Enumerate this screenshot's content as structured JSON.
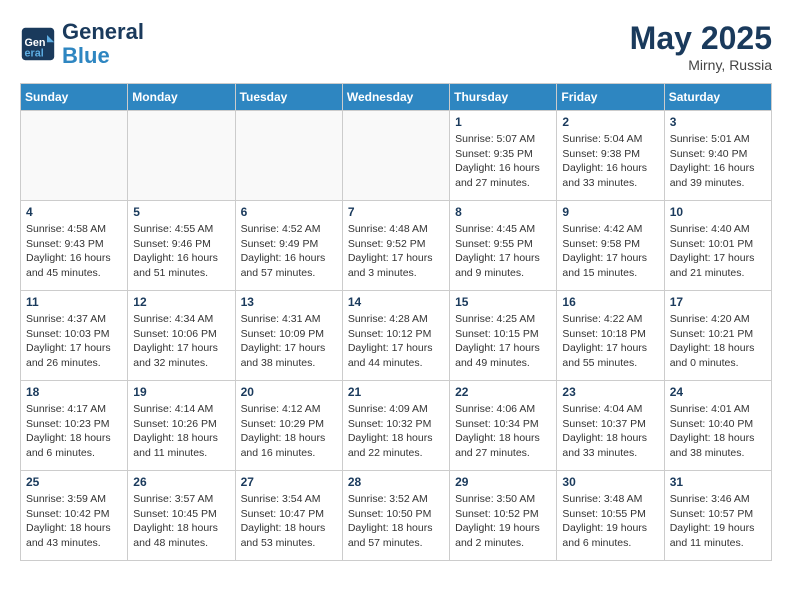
{
  "header": {
    "logo_line1": "General",
    "logo_line2": "Blue",
    "month_year": "May 2025",
    "location": "Mirny, Russia"
  },
  "days_of_week": [
    "Sunday",
    "Monday",
    "Tuesday",
    "Wednesday",
    "Thursday",
    "Friday",
    "Saturday"
  ],
  "weeks": [
    [
      {
        "day": "",
        "info": ""
      },
      {
        "day": "",
        "info": ""
      },
      {
        "day": "",
        "info": ""
      },
      {
        "day": "",
        "info": ""
      },
      {
        "day": "1",
        "info": "Sunrise: 5:07 AM\nSunset: 9:35 PM\nDaylight: 16 hours\nand 27 minutes."
      },
      {
        "day": "2",
        "info": "Sunrise: 5:04 AM\nSunset: 9:38 PM\nDaylight: 16 hours\nand 33 minutes."
      },
      {
        "day": "3",
        "info": "Sunrise: 5:01 AM\nSunset: 9:40 PM\nDaylight: 16 hours\nand 39 minutes."
      }
    ],
    [
      {
        "day": "4",
        "info": "Sunrise: 4:58 AM\nSunset: 9:43 PM\nDaylight: 16 hours\nand 45 minutes."
      },
      {
        "day": "5",
        "info": "Sunrise: 4:55 AM\nSunset: 9:46 PM\nDaylight: 16 hours\nand 51 minutes."
      },
      {
        "day": "6",
        "info": "Sunrise: 4:52 AM\nSunset: 9:49 PM\nDaylight: 16 hours\nand 57 minutes."
      },
      {
        "day": "7",
        "info": "Sunrise: 4:48 AM\nSunset: 9:52 PM\nDaylight: 17 hours\nand 3 minutes."
      },
      {
        "day": "8",
        "info": "Sunrise: 4:45 AM\nSunset: 9:55 PM\nDaylight: 17 hours\nand 9 minutes."
      },
      {
        "day": "9",
        "info": "Sunrise: 4:42 AM\nSunset: 9:58 PM\nDaylight: 17 hours\nand 15 minutes."
      },
      {
        "day": "10",
        "info": "Sunrise: 4:40 AM\nSunset: 10:01 PM\nDaylight: 17 hours\nand 21 minutes."
      }
    ],
    [
      {
        "day": "11",
        "info": "Sunrise: 4:37 AM\nSunset: 10:03 PM\nDaylight: 17 hours\nand 26 minutes."
      },
      {
        "day": "12",
        "info": "Sunrise: 4:34 AM\nSunset: 10:06 PM\nDaylight: 17 hours\nand 32 minutes."
      },
      {
        "day": "13",
        "info": "Sunrise: 4:31 AM\nSunset: 10:09 PM\nDaylight: 17 hours\nand 38 minutes."
      },
      {
        "day": "14",
        "info": "Sunrise: 4:28 AM\nSunset: 10:12 PM\nDaylight: 17 hours\nand 44 minutes."
      },
      {
        "day": "15",
        "info": "Sunrise: 4:25 AM\nSunset: 10:15 PM\nDaylight: 17 hours\nand 49 minutes."
      },
      {
        "day": "16",
        "info": "Sunrise: 4:22 AM\nSunset: 10:18 PM\nDaylight: 17 hours\nand 55 minutes."
      },
      {
        "day": "17",
        "info": "Sunrise: 4:20 AM\nSunset: 10:21 PM\nDaylight: 18 hours\nand 0 minutes."
      }
    ],
    [
      {
        "day": "18",
        "info": "Sunrise: 4:17 AM\nSunset: 10:23 PM\nDaylight: 18 hours\nand 6 minutes."
      },
      {
        "day": "19",
        "info": "Sunrise: 4:14 AM\nSunset: 10:26 PM\nDaylight: 18 hours\nand 11 minutes."
      },
      {
        "day": "20",
        "info": "Sunrise: 4:12 AM\nSunset: 10:29 PM\nDaylight: 18 hours\nand 16 minutes."
      },
      {
        "day": "21",
        "info": "Sunrise: 4:09 AM\nSunset: 10:32 PM\nDaylight: 18 hours\nand 22 minutes."
      },
      {
        "day": "22",
        "info": "Sunrise: 4:06 AM\nSunset: 10:34 PM\nDaylight: 18 hours\nand 27 minutes."
      },
      {
        "day": "23",
        "info": "Sunrise: 4:04 AM\nSunset: 10:37 PM\nDaylight: 18 hours\nand 33 minutes."
      },
      {
        "day": "24",
        "info": "Sunrise: 4:01 AM\nSunset: 10:40 PM\nDaylight: 18 hours\nand 38 minutes."
      }
    ],
    [
      {
        "day": "25",
        "info": "Sunrise: 3:59 AM\nSunset: 10:42 PM\nDaylight: 18 hours\nand 43 minutes."
      },
      {
        "day": "26",
        "info": "Sunrise: 3:57 AM\nSunset: 10:45 PM\nDaylight: 18 hours\nand 48 minutes."
      },
      {
        "day": "27",
        "info": "Sunrise: 3:54 AM\nSunset: 10:47 PM\nDaylight: 18 hours\nand 53 minutes."
      },
      {
        "day": "28",
        "info": "Sunrise: 3:52 AM\nSunset: 10:50 PM\nDaylight: 18 hours\nand 57 minutes."
      },
      {
        "day": "29",
        "info": "Sunrise: 3:50 AM\nSunset: 10:52 PM\nDaylight: 19 hours\nand 2 minutes."
      },
      {
        "day": "30",
        "info": "Sunrise: 3:48 AM\nSunset: 10:55 PM\nDaylight: 19 hours\nand 6 minutes."
      },
      {
        "day": "31",
        "info": "Sunrise: 3:46 AM\nSunset: 10:57 PM\nDaylight: 19 hours\nand 11 minutes."
      }
    ]
  ]
}
